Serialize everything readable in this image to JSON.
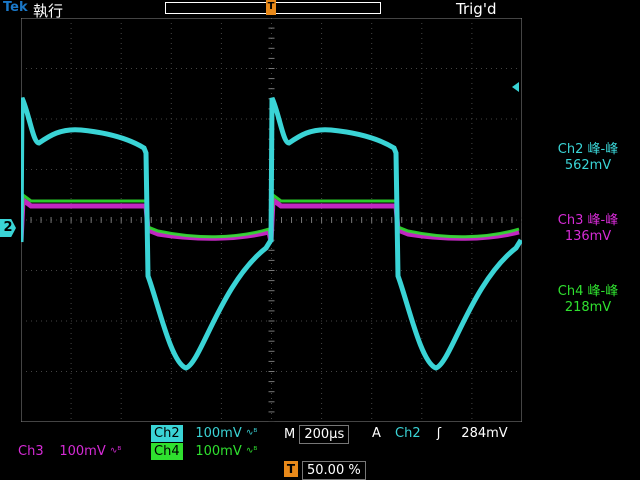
{
  "header": {
    "brand": "Tek",
    "run_state": "執行",
    "trig_state": "Trig'd",
    "trigger_marker": "T"
  },
  "channels": {
    "ch2": {
      "label": "Ch2",
      "color": "#3ad4d6",
      "scale": "100mV",
      "measure_label": "Ch2 峰-峰",
      "measure_value": "562mV",
      "marker": "2"
    },
    "ch3": {
      "label": "Ch3",
      "color": "#d62bd6",
      "scale": "100mV",
      "measure_label": "Ch3 峰-峰",
      "measure_value": "136mV"
    },
    "ch4": {
      "label": "Ch4",
      "color": "#2fe02f",
      "scale": "100mV",
      "measure_label": "Ch4 峰-峰",
      "measure_value": "218mV"
    }
  },
  "timebase": {
    "label": "M",
    "value": "200μs"
  },
  "trigger": {
    "mode": "A",
    "source": "Ch2",
    "slope": "ʃ",
    "level": "284mV"
  },
  "trigger_position": {
    "marker": "T",
    "value": "50.00 %"
  },
  "bw_icon": "bandwidth-limit-icon"
}
